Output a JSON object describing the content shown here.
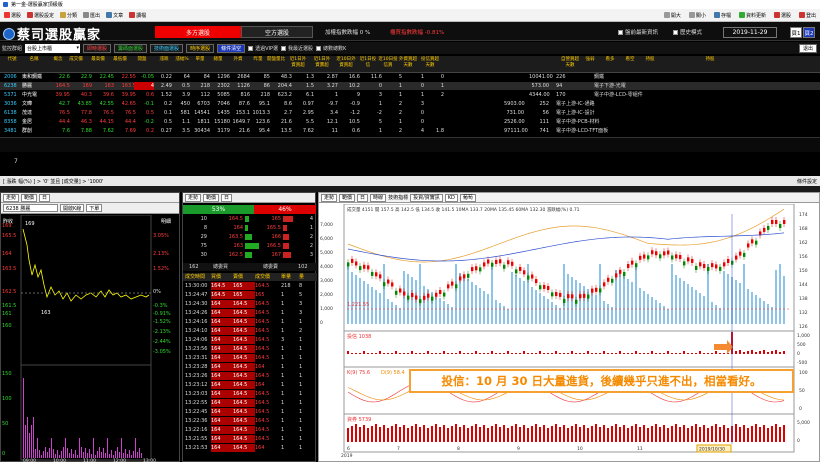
{
  "window": {
    "title": "第一金-選股贏家頂級版"
  },
  "menubar": {
    "items": [
      "選股",
      "選股設定",
      "分類",
      "匯出",
      "文章",
      "讀檔"
    ],
    "right_items": [
      "開大",
      "關小",
      "存檔",
      "資料更新",
      "選股",
      "登出"
    ]
  },
  "banner": {
    "logo_text": "蔡司選股贏家",
    "tab_long": "多方選股",
    "tab_short": "空方選股",
    "info1": "加權指數跌幅 0 %",
    "info2": "櫃買指數跌幅 -0.81%",
    "check1": "盤前最新資訊",
    "check2": "歷史模式",
    "date": "2019-11-29",
    "page_tab1": "頁1",
    "page_tab2": "頁2",
    "exit_label": "退出"
  },
  "controls": {
    "list_label": "監控群組",
    "list_value": "台股上市櫃",
    "btn1": "即時選股",
    "btn2": "籌碼面選股",
    "btn3": "技術面選股",
    "btn4": "時序選股",
    "btn5": "條件清空",
    "chk1": "透過VIP選",
    "chk2": "我最近選股",
    "chk3": "總數總數K"
  },
  "table": {
    "headers": [
      "代號",
      "名稱",
      "概念",
      "成交價",
      "最高價",
      "最低價",
      "開盤",
      "漲跌",
      "漲幅%",
      "單量",
      "總量",
      "外資",
      "昨量",
      "開盤量比",
      "近1日外資買超",
      "近1日外資賣超",
      "近10日外資買超",
      "近1日投信",
      "近10日投信買",
      "外資買超天數",
      "投信買超天數",
      "自營買超天數",
      "強弱",
      "看多",
      "看空",
      "持股",
      "持股",
      "股本",
      "產業"
    ],
    "rows": [
      {
        "code": "2006",
        "name": "東和鋼鐵",
        "c": [
          "22.6",
          "22.9",
          "22.45",
          "22.55",
          "-0.05",
          "0.22",
          "64",
          "84",
          "1296",
          "2684",
          "85",
          "48.3",
          "1.3",
          "2.87",
          "16.6",
          "11.6",
          "5",
          "1",
          "0",
          "",
          "",
          "",
          "",
          "10041.00",
          "226",
          "鋼鐵"
        ]
      },
      {
        "code": "6238",
        "name": "勝麗",
        "c": [
          "164.5",
          "169",
          "163",
          "163.5",
          "4",
          "2.49",
          "0.5",
          "218",
          "2302",
          "1126",
          "86",
          "204.4",
          "1.5",
          "3.27",
          "10.2",
          "0",
          "1",
          "0",
          "1",
          "",
          "",
          "",
          "",
          "573.00",
          "94",
          "電子下游-光電"
        ]
      },
      {
        "code": "5371",
        "name": "中光電",
        "c": [
          "39.95",
          "40.3",
          "39.6",
          "39.95",
          "0.6",
          "1.52",
          "3.9",
          "112",
          "5085",
          "816",
          "218",
          "623.2",
          "6.1",
          "1",
          "9",
          "3",
          "1",
          "1",
          "2",
          "",
          "",
          "",
          "",
          "4344.00",
          "170",
          "電子中游-LCD-零組件"
        ]
      },
      {
        "code": "3036",
        "name": "文曄",
        "c": [
          "42.7",
          "43.85",
          "42.55",
          "42.65",
          "-0.1",
          "0.2",
          "450",
          "6703",
          "7046",
          "87.6",
          "95.1",
          "8.6",
          "0.97",
          "-9.7",
          "-0.9",
          "1",
          "2",
          "3",
          "",
          "",
          "",
          "",
          "5903.00",
          "252",
          "電子上游-IC-通路"
        ]
      },
      {
        "code": "6138",
        "name": "茂達",
        "c": [
          "76.5",
          "77.8",
          "76.5",
          "76.5",
          "0.5",
          "0.1",
          "581",
          "14541",
          "1435",
          "153.1",
          "1013.3",
          "2.7",
          "2.95",
          "3.4",
          "-1.2",
          "-2",
          "2",
          "0",
          "",
          "",
          "",
          "",
          "731.00",
          "56",
          "電子上游-IC-設計"
        ]
      },
      {
        "code": "8358",
        "name": "金居",
        "c": [
          "44.4",
          "46.3",
          "44.15",
          "44.4",
          "-0.2",
          "0.5",
          "1.1",
          "1811",
          "15180",
          "1649.7",
          "123.6",
          "21.6",
          "5.5",
          "12.1",
          "10.5",
          "5",
          "1",
          "0",
          "",
          "",
          "",
          "",
          "2526.00",
          "111",
          "電子中游-PCB-材料"
        ]
      },
      {
        "code": "3481",
        "name": "群創",
        "c": [
          "7.6",
          "7.88",
          "7.62",
          "7.69",
          "0.2",
          "0.27",
          "3.5",
          "30434",
          "3179",
          "21.6",
          "95.4",
          "13.5",
          "7.62",
          "11",
          "0.6",
          "1",
          "2",
          "4",
          "1.8",
          "",
          "",
          "",
          "97111.00",
          "741",
          "電子中游-LCD-TFT面板"
        ]
      }
    ]
  },
  "status": {
    "count": "7",
    "breadcrumb": "[ 漲跌 幅(%) ] > '0' 並且 [成交量] > '1000'",
    "right": "條件設定"
  },
  "panel1": {
    "tabs": [
      "走勢",
      "範價",
      "日"
    ],
    "stock": "6238 勝麗",
    "btn1": "開啟K線",
    "btn2": "下單",
    "top_label": "昨收",
    "right_label": "明細",
    "ylabels_left": [
      "169",
      "165.5",
      "164",
      "163.5",
      "162.5",
      "161.5",
      "161",
      "160",
      "150",
      "100",
      "50",
      "0"
    ],
    "ylabels_right": [
      "3.05%",
      "2.13%",
      "1.52%",
      "0%",
      "-0.3%",
      "-0.91%",
      "-1.52%",
      "-2.13%",
      "-2.44%",
      "-3.05%"
    ],
    "vol_labels": [
      "150",
      "100",
      "50",
      "0"
    ],
    "xlabels": [
      "09:00",
      "10:00",
      "11:00",
      "12:00",
      "13:00"
    ],
    "high_mark": "169",
    "low_mark": "163"
  },
  "panel2": {
    "tabs": [
      "走勢",
      "範價",
      "日"
    ],
    "buy_pct": "53%",
    "sell_pct": "46%",
    "book": [
      {
        "bq": "10",
        "bp": "164.5",
        "sp": "165",
        "sq": "4"
      },
      {
        "bq": "8",
        "bp": "164",
        "sp": "165.5",
        "sq": "1"
      },
      {
        "bq": "29",
        "bp": "163.5",
        "sp": "166",
        "sq": "2"
      },
      {
        "bq": "75",
        "bp": "163",
        "sp": "166.5",
        "sq": "2"
      },
      {
        "bq": "30",
        "bp": "162.5",
        "sp": "167",
        "sq": "3"
      }
    ],
    "total_buy": "162",
    "total_label": "總委買",
    "total_sell_label": "總委賣",
    "total_sell": "102",
    "det_headers": [
      "成交時間",
      "買價",
      "賣價",
      "成交價",
      "單量",
      "量"
    ],
    "details": [
      [
        "13:30:00",
        "164.5",
        "165",
        "164.5",
        "218",
        "8"
      ],
      [
        "13:24:47",
        "164.5",
        "165",
        "165",
        "1",
        "5"
      ],
      [
        "13:24:30",
        "164",
        "164.5",
        "164.5",
        "1",
        "3"
      ],
      [
        "13:24:26",
        "164",
        "164.5",
        "164.5",
        "1",
        "3"
      ],
      [
        "13:24:16",
        "164",
        "164.5",
        "164.5",
        "1",
        "1"
      ],
      [
        "13:24:10",
        "164",
        "164.5",
        "164.5",
        "1",
        "2"
      ],
      [
        "13:24:06",
        "164",
        "164.5",
        "164.5",
        "3",
        "1"
      ],
      [
        "13:23:56",
        "164",
        "164.5",
        "164.5",
        "1",
        "1"
      ],
      [
        "13:23:31",
        "164",
        "164.5",
        "164.5",
        "1",
        "1"
      ],
      [
        "13:23:28",
        "164",
        "164.5",
        "164",
        "1",
        "1"
      ],
      [
        "13:23:26",
        "164",
        "164.5",
        "164.5",
        "1",
        "1"
      ],
      [
        "13:23:12",
        "164",
        "164.5",
        "164",
        "1",
        "1"
      ],
      [
        "13:23:03",
        "164",
        "164.5",
        "164.5",
        "1",
        "1"
      ],
      [
        "13:22:55",
        "164",
        "164.5",
        "164.5",
        "1",
        "1"
      ],
      [
        "13:22:45",
        "164",
        "164.5",
        "164.5",
        "1",
        "1"
      ],
      [
        "13:22:36",
        "164",
        "164.5",
        "164.5",
        "1",
        "1"
      ],
      [
        "13:22:16",
        "164",
        "164.5",
        "164.5",
        "1",
        "1"
      ],
      [
        "13:21:55",
        "164",
        "164.5",
        "164.5",
        "1",
        "1"
      ],
      [
        "13:21:53",
        "164",
        "164.5",
        "164",
        "1",
        "1"
      ]
    ]
  },
  "panel3": {
    "tabs": [
      "走勢",
      "範價",
      "日"
    ],
    "period": "時線",
    "tool": "技術指標",
    "select1": "投資/資實訊",
    "select2": "KD",
    "select3": "葡萄",
    "legend": "成交量 4151  開 157.5  高 142.5  低 134.5  收 141.5   10MA 133.7   20MA 135.45   60MA 132.30   漲跌幅(%) 0.71",
    "price_axis": [
      "174",
      "168",
      "162",
      "156",
      "150",
      "144",
      "138",
      "132",
      "126"
    ],
    "vol_axis": [
      "7,000",
      "6,000",
      "5,000",
      "4,000",
      "3,000",
      "2,000",
      "1,000",
      "0"
    ],
    "mark_price": "1,221.55",
    "inv_label": "投信 1038",
    "inv_axis": [
      "1,000",
      "500",
      "0",
      "-500"
    ],
    "kd_label1": "K(9) 75.6",
    "kd_label2": "D(9) 58.4",
    "kd_axis": [
      "100",
      "50",
      "0"
    ],
    "margin_label": "資券 5739",
    "margin_axis": [
      "5,000",
      "0"
    ],
    "xlabels": [
      "6",
      "7",
      "8",
      "9",
      "10",
      "11"
    ],
    "year": "2019",
    "date_mark": "2019/10/30",
    "annotation": "投信：10 月 30 日大量進貨，後續幾乎只進不出，相當看好。"
  }
}
